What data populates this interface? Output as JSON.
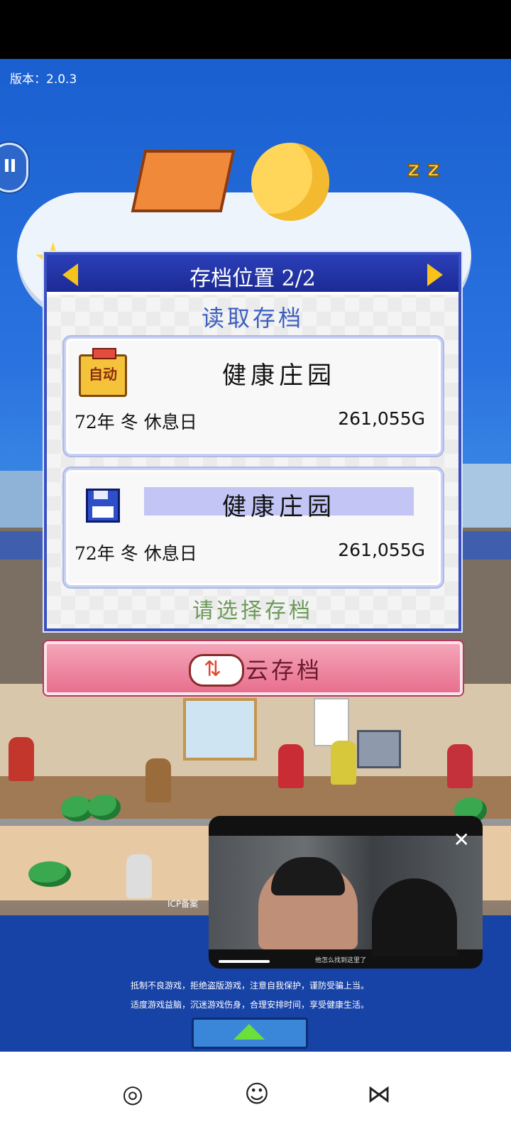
{
  "version": {
    "label": "版本：2.0.3"
  },
  "dialog": {
    "title": "存档位置 2/2",
    "subtitle": "读取存档",
    "prompt": "请选择存档",
    "slots": [
      {
        "badge": "自动",
        "name": "健康庄园",
        "date": "72年 冬 休息日",
        "money": "261,055G"
      },
      {
        "name": "健康庄园",
        "date": "72年 冬 休息日",
        "money": "261,055G"
      }
    ]
  },
  "cloud_save": {
    "label": "云存档"
  },
  "notice": {
    "line1": "抵制不良游戏，拒绝盗版游戏，注意自我保护，谨防受骗上当。",
    "line2": "适度游戏益脑，沉迷游戏伤身，合理安排时间，享受健康生活。"
  },
  "icp": "ICP备案",
  "video": {
    "close": "✕",
    "subtitle": "他怎么找到这里了"
  },
  "nav": {
    "icons": [
      "ball-icon",
      "mascot-icon",
      "butterfly-icon"
    ]
  }
}
